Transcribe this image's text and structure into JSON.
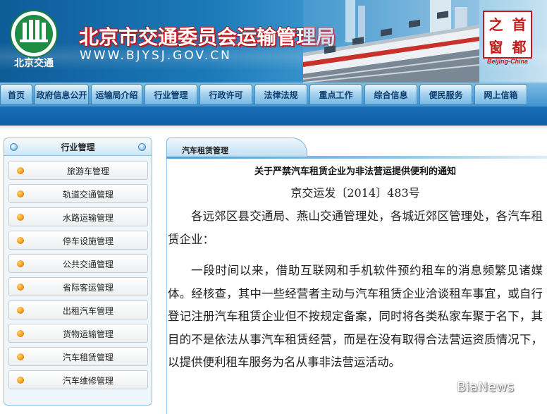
{
  "header": {
    "title": "北京市交通委员会运输管理局",
    "url": "WWW.BJYSJ.GOV.CN",
    "logo": {
      "icon": "bjjt-logo-icon",
      "text": "北京交通"
    },
    "seal": {
      "chars": [
        "首",
        "之",
        "都",
        "窗"
      ],
      "caption": "Beijing-China"
    }
  },
  "nav": {
    "items": [
      {
        "label": "首页"
      },
      {
        "label": "政府信息公开"
      },
      {
        "label": "运输局介绍"
      },
      {
        "label": "行业管理"
      },
      {
        "label": "行政许可"
      },
      {
        "label": "法律法规"
      },
      {
        "label": "重点工作"
      },
      {
        "label": "综合信息"
      },
      {
        "label": "便民服务"
      },
      {
        "label": "网上信箱"
      }
    ]
  },
  "sidebar": {
    "title": "行业管理",
    "items": [
      {
        "label": "旅游车管理"
      },
      {
        "label": "轨道交通管理"
      },
      {
        "label": "水路运输管理"
      },
      {
        "label": "停车设施管理"
      },
      {
        "label": "公共交通管理"
      },
      {
        "label": "省际客运管理"
      },
      {
        "label": "出租汽车管理"
      },
      {
        "label": "货物运输管理"
      },
      {
        "label": "汽车租赁管理"
      },
      {
        "label": "汽车维修管理"
      }
    ]
  },
  "content": {
    "tab_label": "汽车租赁管理",
    "article": {
      "title": "关于严禁汽车租赁企业为非法营运提供便利的通知",
      "doc_number": "京交运发〔2014〕483号",
      "para1": "各远郊区县交通局、燕山交通管理处，各城近郊区管理处，各汽车租赁企业：",
      "para2": "一段时间以来，借助互联网和手机软件预约租车的消息频繁见诸媒体。经核查，其中一些经营者主动与汽车租赁企业洽谈租车事宜，或自行登记注册汽车租赁企业但不按规定备案，同时将各类私家车聚于名下，其目的不是依法从事汽车租赁经营，而是在没有取得合法营运资质情况下，以提供便利租车服务为名从事非法营运活动。"
    }
  },
  "watermark": {
    "icon": "wechat-icon",
    "text": "BiaNews"
  },
  "colors": {
    "header_blue": "#1b79b8",
    "title_red_outline": "#c7151a",
    "nav_text": "#0b3d6e",
    "band_blue": "#0b5ea8",
    "bullet_orange": "#f39a1d"
  }
}
